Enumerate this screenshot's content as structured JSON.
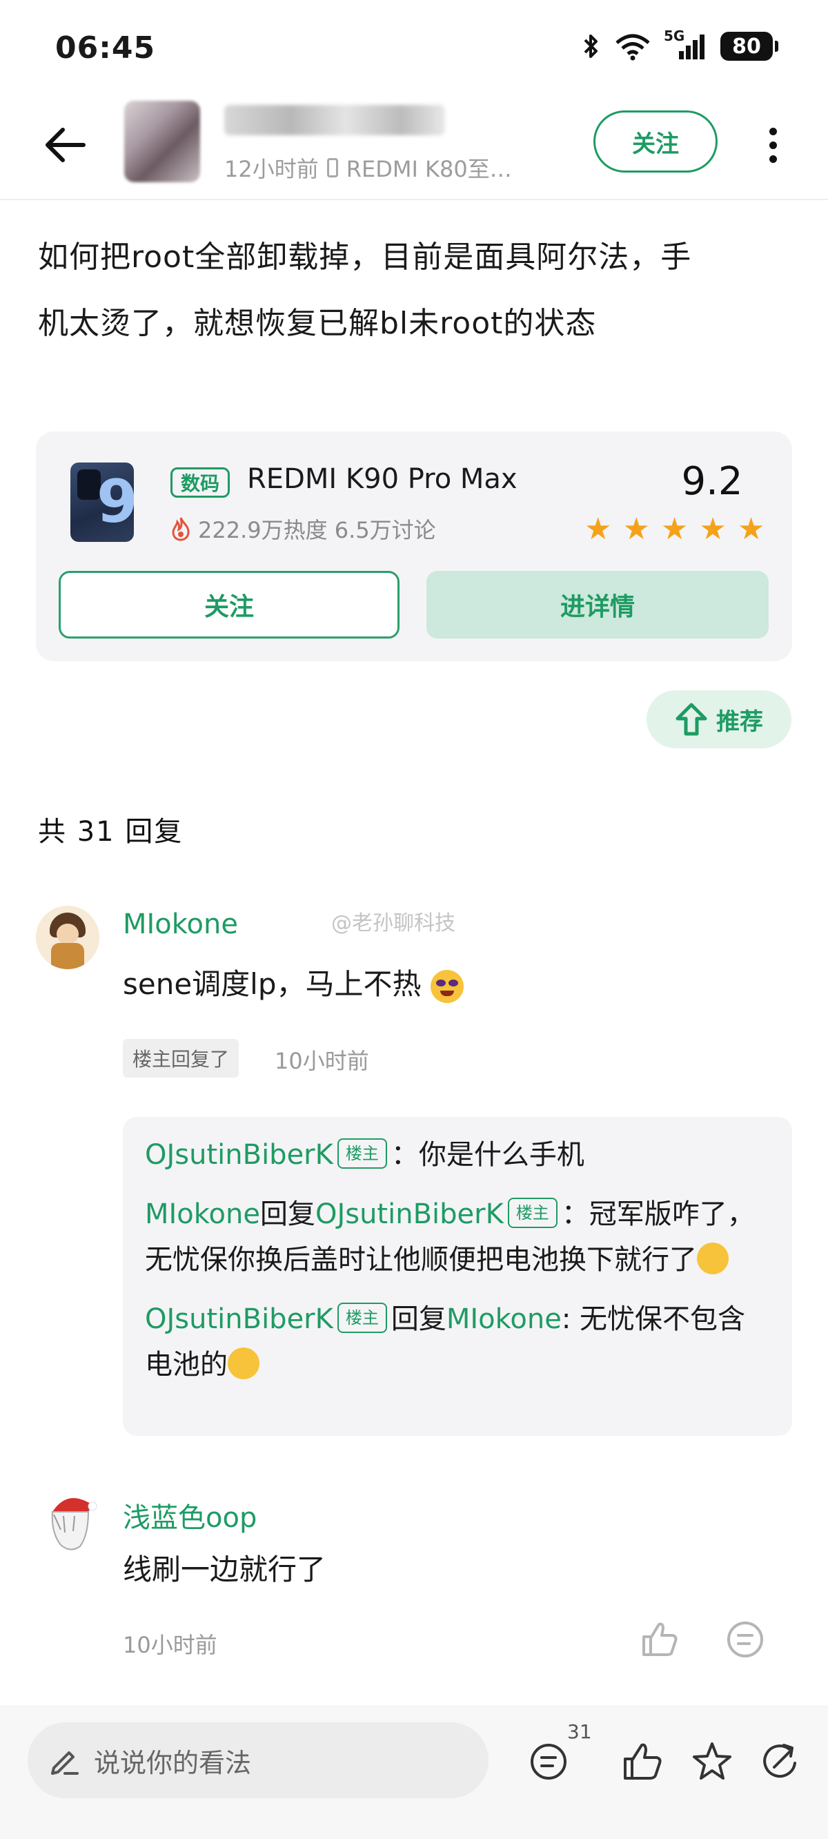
{
  "status_bar": {
    "time": "06:45",
    "battery": "80",
    "network": "5G"
  },
  "header": {
    "author_name": "",
    "meta_time": "12小时前",
    "meta_device": "REDMI K80至…",
    "follow_label": "关注"
  },
  "post": {
    "text_line1": "如何把root全部卸载掉，目前是面具阿尔法，手",
    "text_line2": "机太烫了，就想恢复已解bl未root的状态"
  },
  "product": {
    "tag": "数码",
    "name": "REDMI K90 Pro Max",
    "stats": "222.9万热度 6.5万讨论",
    "score": "9.2",
    "rating_stars": 5,
    "follow_label": "关注",
    "detail_label": "进详情"
  },
  "recommend_label": "推荐",
  "reply_count": "共 31 回复",
  "watermark": "@老孙聊科技",
  "comments": [
    {
      "name": "MIokone",
      "text": "sene调度lp，马上不热",
      "badge": "楼主回复了",
      "time": "10小时前",
      "replies": [
        {
          "from": "OJsutinBiberK",
          "op_tag": "楼主",
          "text": "：你是什么手机"
        },
        {
          "from": "MIokone",
          "reply_word": "回复",
          "to": "OJsutinBiberK",
          "op_tag": "楼主",
          "text": "：冠军版咋了，无忧保你换后盖时让他顺便把电池换下就行了"
        },
        {
          "from": "OJsutinBiberK",
          "op_tag": "楼主",
          "reply_word": "回复",
          "to": "MIokone",
          "text": ": 无忧保不包含电池的"
        }
      ]
    },
    {
      "name": "浅蓝色oop",
      "text": "线刷一边就行了",
      "time": "10小时前"
    }
  ],
  "bottom_bar": {
    "input_placeholder": "说说你的看法",
    "comment_count": "31"
  },
  "colors": {
    "accent": "#1e9b63",
    "star": "#f5a21b",
    "card_bg": "#f4f4f6"
  },
  "icons": [
    "back-arrow-icon",
    "more-icon",
    "fire-icon",
    "star-icon",
    "thumb-up-icon",
    "comment-icon",
    "pen-icon",
    "favorite-star-icon",
    "share-icon",
    "arrow-up-icon",
    "bluetooth-icon",
    "wifi-icon",
    "signal-icon"
  ]
}
